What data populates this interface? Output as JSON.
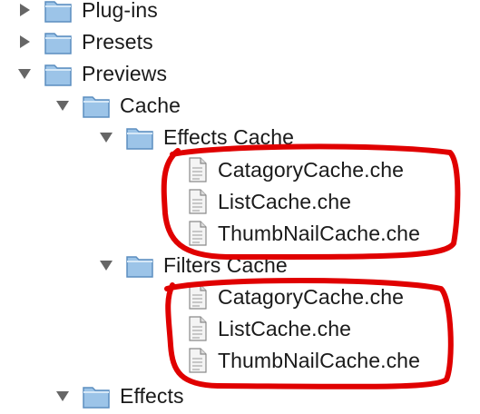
{
  "tree": {
    "rows": [
      {
        "label": "Plug-ins",
        "kind": "folder",
        "disclosure": "collapsed"
      },
      {
        "label": "Presets",
        "kind": "folder",
        "disclosure": "collapsed"
      },
      {
        "label": "Previews",
        "kind": "folder",
        "disclosure": "expanded"
      },
      {
        "label": "Cache",
        "kind": "folder",
        "disclosure": "expanded"
      },
      {
        "label": "Effects Cache",
        "kind": "folder",
        "disclosure": "expanded"
      },
      {
        "label": "CatagoryCache.che",
        "kind": "file"
      },
      {
        "label": "ListCache.che",
        "kind": "file"
      },
      {
        "label": "ThumbNailCache.che",
        "kind": "file"
      },
      {
        "label": "Filters Cache",
        "kind": "folder",
        "disclosure": "expanded"
      },
      {
        "label": "CatagoryCache.che",
        "kind": "file"
      },
      {
        "label": "ListCache.che",
        "kind": "file"
      },
      {
        "label": "ThumbNailCache.che",
        "kind": "file"
      },
      {
        "label": "Effects",
        "kind": "folder",
        "disclosure": "expanded"
      }
    ]
  },
  "colors": {
    "disclosure": "#666666",
    "folder_fill": "#9cc4e8",
    "folder_edge": "#5b8dbf",
    "annotation": "#e00000"
  },
  "icons": {
    "disclosure_collapsed": "triangle-right-icon",
    "disclosure_expanded": "triangle-down-icon",
    "folder": "folder-icon",
    "file": "document-icon"
  }
}
